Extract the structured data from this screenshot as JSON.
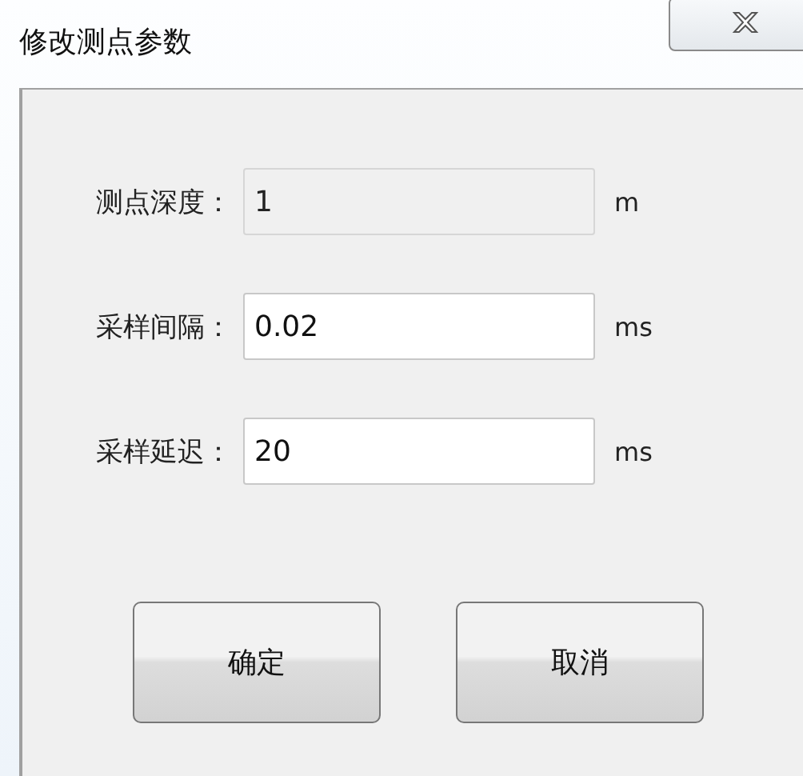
{
  "window": {
    "title": "修改测点参数"
  },
  "fields": [
    {
      "label": "测点深度：",
      "value": "1",
      "unit": "m",
      "disabled": true
    },
    {
      "label": "采样间隔：",
      "value": "0.02",
      "unit": "ms",
      "disabled": false
    },
    {
      "label": "采样延迟：",
      "value": "20",
      "unit": "ms",
      "disabled": false
    }
  ],
  "buttons": [
    "确定",
    "取消"
  ]
}
